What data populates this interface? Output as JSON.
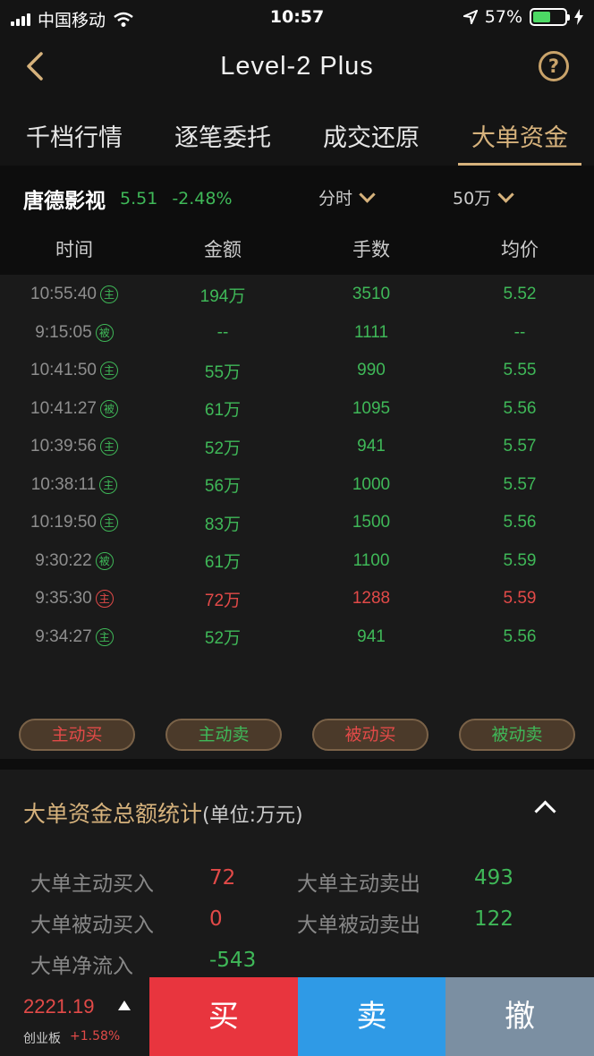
{
  "status_bar": {
    "carrier": "中国移动",
    "time": "10:57",
    "battery": "57%",
    "battery_level": 0.57
  },
  "nav": {
    "title": "Level-2 Plus",
    "help": "?"
  },
  "tabs": [
    {
      "label": "千档行情",
      "active": false
    },
    {
      "label": "逐笔委托",
      "active": false
    },
    {
      "label": "成交还原",
      "active": false
    },
    {
      "label": "大单资金",
      "active": true
    }
  ],
  "stock": {
    "name": "唐德影视",
    "price": "5.51",
    "change": "-2.48%",
    "time_selector": "分时",
    "threshold_selector": "50万"
  },
  "columns": [
    "时间",
    "金额",
    "手数",
    "均价"
  ],
  "rows": [
    {
      "time": "10:55:40",
      "badge": "主",
      "amount": "194万",
      "lots": "3510",
      "avg": "5.52",
      "color": "green"
    },
    {
      "time": "9:15:05",
      "badge": "被",
      "amount": "--",
      "lots": "1111",
      "avg": "--",
      "color": "green"
    },
    {
      "time": "10:41:50",
      "badge": "主",
      "amount": "55万",
      "lots": "990",
      "avg": "5.55",
      "color": "green"
    },
    {
      "time": "10:41:27",
      "badge": "被",
      "amount": "61万",
      "lots": "1095",
      "avg": "5.56",
      "color": "green"
    },
    {
      "time": "10:39:56",
      "badge": "主",
      "amount": "52万",
      "lots": "941",
      "avg": "5.57",
      "color": "green"
    },
    {
      "time": "10:38:11",
      "badge": "主",
      "amount": "56万",
      "lots": "1000",
      "avg": "5.57",
      "color": "green"
    },
    {
      "time": "10:19:50",
      "badge": "主",
      "amount": "83万",
      "lots": "1500",
      "avg": "5.56",
      "color": "green"
    },
    {
      "time": "9:30:22",
      "badge": "被",
      "amount": "61万",
      "lots": "1100",
      "avg": "5.59",
      "color": "green"
    },
    {
      "time": "9:35:30",
      "badge": "主",
      "amount": "72万",
      "lots": "1288",
      "avg": "5.59",
      "color": "red"
    },
    {
      "time": "9:34:27",
      "badge": "主",
      "amount": "52万",
      "lots": "941",
      "avg": "5.56",
      "color": "green"
    }
  ],
  "legend": [
    {
      "label": "主动买",
      "color": "red"
    },
    {
      "label": "主动卖",
      "color": "green"
    },
    {
      "label": "被动买",
      "color": "red"
    },
    {
      "label": "被动卖",
      "color": "green"
    }
  ],
  "stats": {
    "title": "大单资金总额统计",
    "unit": "(单位:万元)",
    "active_buy_label": "大单主动买入",
    "active_buy": "72",
    "active_sell_label": "大单主动卖出",
    "active_sell": "493",
    "passive_buy_label": "大单被动买入",
    "passive_buy": "0",
    "passive_sell_label": "大单被动卖出",
    "passive_sell": "122",
    "net_inflow_label": "大单净流入",
    "net_inflow": "-543"
  },
  "bottom": {
    "index_value": "2221.19",
    "index_name": "创业板",
    "index_change": "+1.58%",
    "buy": "买",
    "sell": "卖",
    "cancel": "撤"
  },
  "colors": {
    "gold": "#d6b27c",
    "green": "#3fb858",
    "red": "#e24a48",
    "buy_button": "#e8353e",
    "sell_button": "#2f9ae6",
    "cancel_button": "#7b8fa2"
  }
}
